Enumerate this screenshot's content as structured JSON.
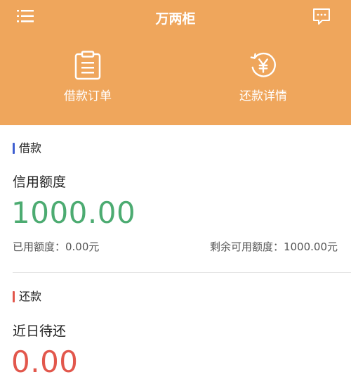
{
  "header": {
    "title": "万两柜",
    "menu_icon": "menu-icon",
    "message_icon": "message-icon",
    "background": "#efa65c"
  },
  "quick_actions": [
    {
      "label": "借款订单",
      "icon": "clipboard-icon"
    },
    {
      "label": "还款详情",
      "icon": "repay-yen-icon"
    }
  ],
  "loan": {
    "section_title": "借款",
    "accent": "#3f5fd1",
    "credit_label": "信用额度",
    "credit_amount": "1000.00",
    "used_label": "已用额度：0.00元",
    "available_label": "剩余可用额度：1000.00元"
  },
  "repay": {
    "section_title": "还款",
    "accent": "#e2574c",
    "due_label": "近日待还",
    "due_amount": "0.00"
  }
}
